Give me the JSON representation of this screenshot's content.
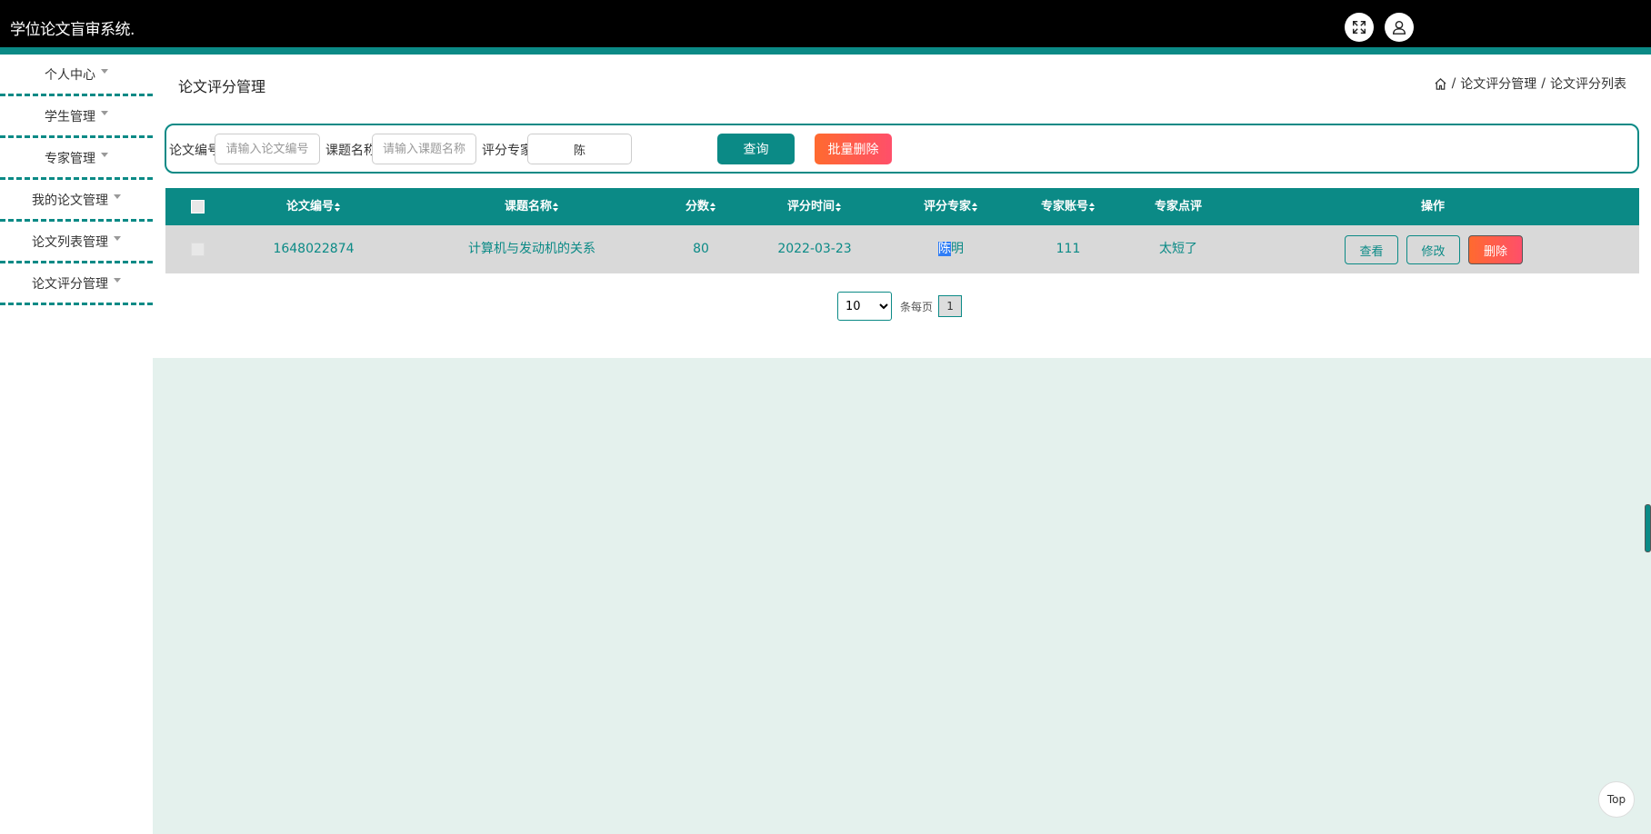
{
  "header": {
    "title": "学位论文盲审系统.",
    "fullscreen_icon": "expand-icon",
    "user_icon": "user-icon"
  },
  "sidebar": {
    "items": [
      {
        "label": "个人中心"
      },
      {
        "label": "学生管理"
      },
      {
        "label": "专家管理"
      },
      {
        "label": "我的论文管理"
      },
      {
        "label": "论文列表管理"
      },
      {
        "label": "论文评分管理"
      }
    ]
  },
  "page": {
    "title": "论文评分管理",
    "breadcrumb": [
      "论文评分管理",
      "论文评分列表"
    ],
    "breadcrumb_sep": "/"
  },
  "search": {
    "paper_no_label": "论文编号",
    "paper_no_placeholder": "请输入论文编号",
    "topic_label": "课题名称",
    "topic_placeholder": "请输入课题名称",
    "expert_label": "评分专家",
    "expert_value": "陈",
    "query_label": "查询",
    "batch_delete_label": "批量删除"
  },
  "table": {
    "columns": [
      "论文编号",
      "课题名称",
      "分数",
      "评分时间",
      "评分专家",
      "专家账号",
      "专家点评",
      "操作"
    ],
    "rows": [
      {
        "paper_no": "1648022874",
        "topic": "计算机与发动机的关系",
        "score": "80",
        "time": "2022-03-23",
        "expert_hl": "陈",
        "expert_rest": "明",
        "account": "111",
        "comment": "太短了",
        "view": "查看",
        "edit": "修改",
        "delete": "删除"
      }
    ]
  },
  "pager": {
    "size": "10",
    "size_options": [
      "10"
    ],
    "per_page_label": "条每页",
    "current": "1"
  },
  "top_label": "Top",
  "colors": {
    "accent": "#0b8a86",
    "danger": "#ff5a4f",
    "header_bg": "#000000",
    "page_bg": "#e4f1ed"
  }
}
